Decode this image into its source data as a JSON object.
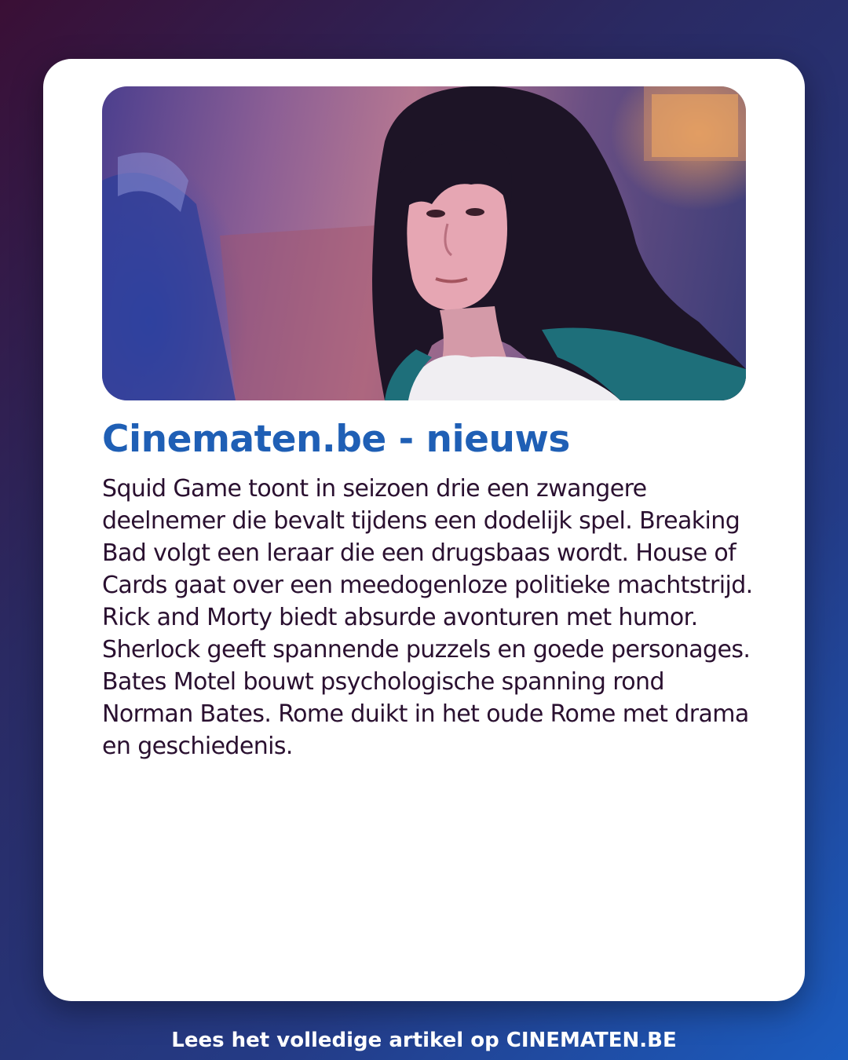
{
  "article": {
    "image_alt": "Still of a young woman with dark hair in a dim, purple-lit room",
    "title": "Cinematen.be - nieuws",
    "body": "Squid Game toont in seizoen drie een zwangere deelnemer die bevalt tijdens een dodelijk spel. Breaking Bad volgt een leraar die een drugsbaas wordt. House of Cards gaat over een meedogenloze politieke machtstrijd. Rick and Morty biedt absurde avonturen met humor. Sherlock geeft spannende puzzels en goede personages. Bates Motel bouwt psychologische spanning rond Norman Bates. Rome duikt in het oude Rome met drama en geschiedenis."
  },
  "footer": {
    "cta": "Lees het volledige artikel op CINEMATEN.BE"
  },
  "colors": {
    "accent": "#1f5fb5",
    "text": "#2a1030",
    "card": "#ffffff"
  }
}
